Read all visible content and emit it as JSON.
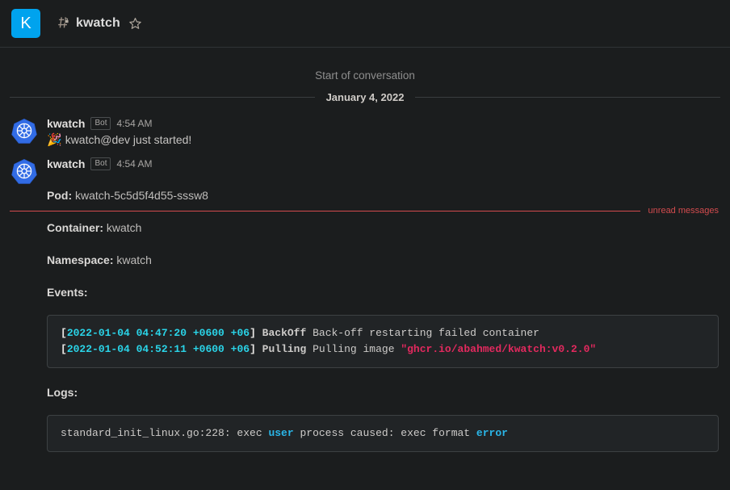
{
  "header": {
    "team_avatar_letter": "K",
    "channel_icon": "private-channel-hash-lock-icon",
    "channel_name": "kwatch",
    "favorite_icon": "star-icon"
  },
  "conversation": {
    "start_label": "Start of conversation",
    "date_label": "January 4, 2022",
    "unread_label": "unread messages"
  },
  "posts": [
    {
      "avatar_icon": "kubernetes-logo-icon",
      "username": "kwatch",
      "badge": "Bot",
      "timestamp": "4:54 AM",
      "emoji": "🎉",
      "text": "kwatch@dev just started!"
    },
    {
      "avatar_icon": "kubernetes-logo-icon",
      "username": "kwatch",
      "badge": "Bot",
      "timestamp": "4:54 AM",
      "fields": [
        {
          "label": "Pod:",
          "value": "kwatch-5c5d5f4d55-sssw8"
        },
        {
          "label": "Container:",
          "value": "kwatch"
        },
        {
          "label": "Namespace:",
          "value": "kwatch"
        },
        {
          "label": "Events:",
          "value": ""
        }
      ],
      "events_code": {
        "line1": {
          "open_bracket": "[",
          "timestamp": "2022-01-04 04:47:20 +0600 +06",
          "close_bracket": "]",
          "reason": " BackOff",
          "message": " Back-off restarting failed container"
        },
        "line2": {
          "open_bracket": "[",
          "timestamp": "2022-01-04 04:52:11 +0600 +06",
          "close_bracket": "]",
          "reason": " Pulling",
          "message": " Pulling image ",
          "image": "\"ghcr.io/abahmed/kwatch:v0.2.0\""
        }
      },
      "logs_label": "Logs:",
      "logs_code": {
        "part1": "standard_init_linux.go:228: exec ",
        "ident1": "user",
        "part2": " process caused: exec format ",
        "ident2": "error"
      }
    }
  ],
  "colors": {
    "page_background": "#1b1d1e",
    "accent_blue": "#00a3ee",
    "unread_red": "#d24b4e",
    "code_background": "#212426",
    "code_timestamp": "#2ad4e8",
    "code_string_red": "#e2295e",
    "code_identifier_blue": "#2ab6e8"
  }
}
